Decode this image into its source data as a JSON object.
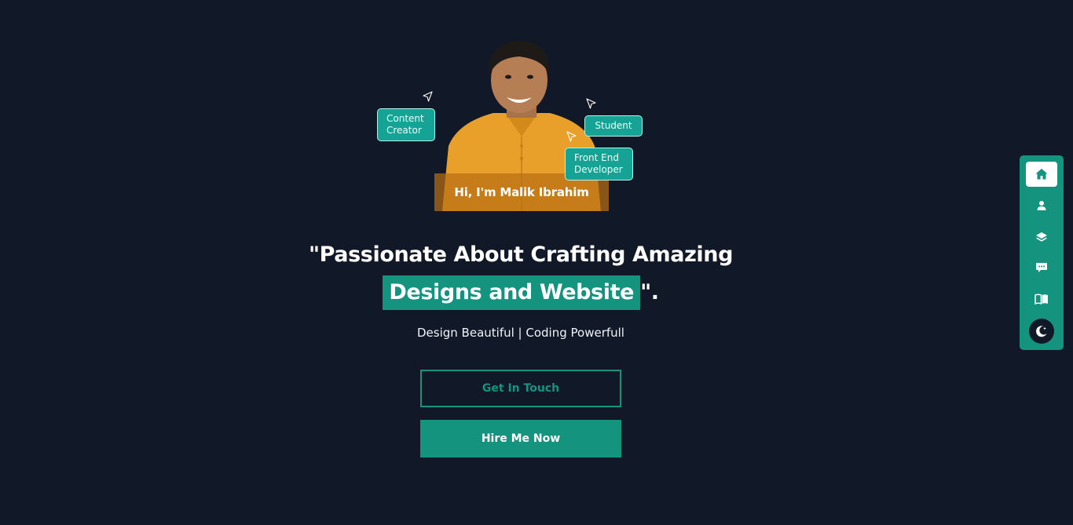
{
  "hero": {
    "greeting": "Hi, I'm Malik Ibrahim",
    "tags": {
      "content_creator": "Content\nCreator",
      "student": "Student",
      "front_end": "Front End\nDeveloper"
    }
  },
  "headline": {
    "line1": "\"Passionate About Crafting Amazing",
    "highlight": "Designs and Website",
    "suffix": "\"."
  },
  "subtitle": "Design Beautiful | Coding Powerfull",
  "buttons": {
    "get_in_touch": "Get In Touch",
    "hire_me": "Hire Me Now"
  },
  "sidenav": {
    "items": [
      {
        "icon": "home-icon",
        "active": true
      },
      {
        "icon": "user-icon",
        "active": false
      },
      {
        "icon": "layers-icon",
        "active": false
      },
      {
        "icon": "chat-icon",
        "active": false
      },
      {
        "icon": "book-icon",
        "active": false
      }
    ],
    "theme_toggle_icon": "moon-icon"
  },
  "colors": {
    "background": "#111827",
    "accent": "#14937f",
    "tag": "#14a394",
    "white": "#ffffff"
  }
}
